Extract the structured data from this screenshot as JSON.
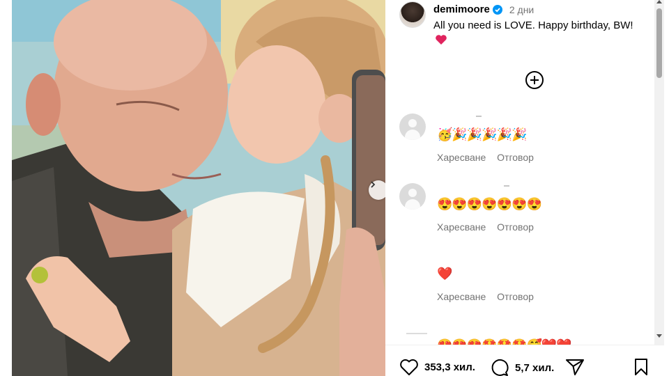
{
  "post": {
    "owner": "demimoore",
    "time": "2 дни",
    "caption": "All you need is LOVE. Happy birthday, BW!",
    "caption_emoji": "❤️"
  },
  "comments": [
    {
      "text": "🥳🎉🎉🎉🎉🎉",
      "like_label": "Харесване",
      "reply_label": "Отговор"
    },
    {
      "text": "😍😍😍😍😍😍😍",
      "like_label": "Харесване",
      "reply_label": "Отговор"
    },
    {
      "text": "❤️",
      "like_label": "Харесване",
      "reply_label": "Отговор"
    }
  ],
  "partial_comment": "😍😍😍🤩🤩🤩🥰❤️❤️",
  "actions": {
    "likes": "353,3 хил.",
    "comments": "5,7 хил."
  },
  "icons": {
    "like": "heart-outline-icon",
    "comment": "comment-bubble-icon",
    "share": "paper-plane-icon",
    "save": "bookmark-icon",
    "add": "add-circle-icon",
    "verified": "verified-badge-icon",
    "next": "chevron-right-icon"
  },
  "colors": {
    "verified": "#0095f6",
    "heart": "#e0245e",
    "secondary_text": "#737373"
  }
}
